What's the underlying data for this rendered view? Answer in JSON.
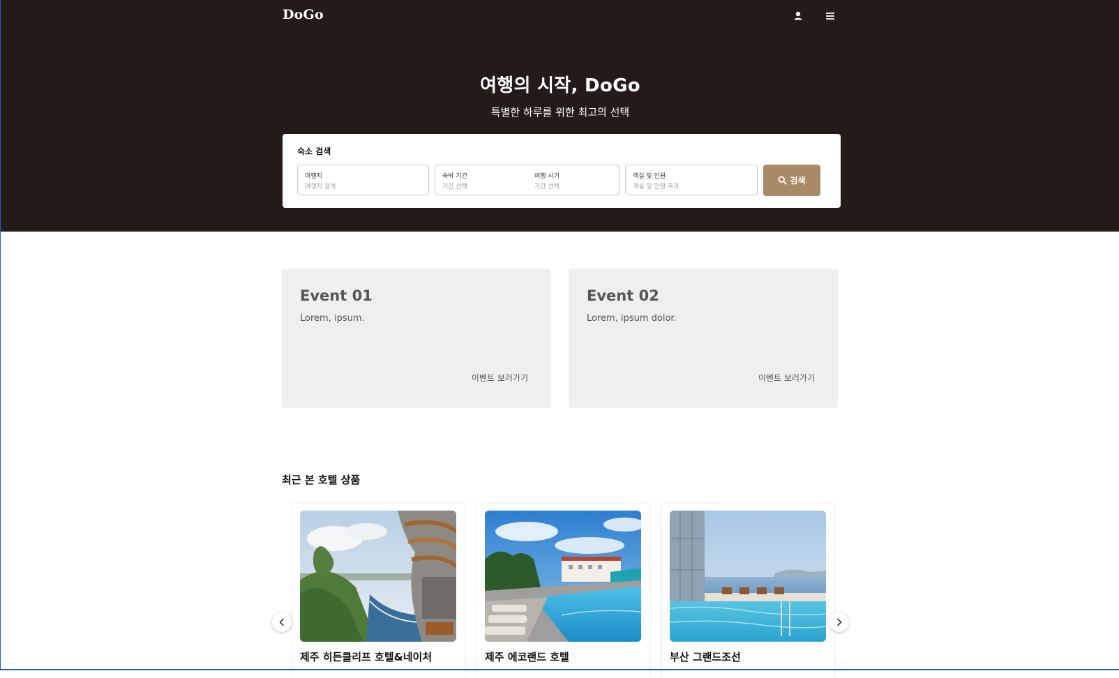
{
  "header": {
    "logo": "DoGo",
    "user_icon": "user-icon",
    "menu_icon": "hamburger-menu-icon"
  },
  "hero": {
    "title": "여행의 시작, DoGo",
    "subtitle": "특별한 하루를 위한 최고의 선택"
  },
  "search": {
    "title": "숙소 검색",
    "destination": {
      "label": "여행지",
      "placeholder": "여행지 검색"
    },
    "stay_period": {
      "label": "숙박 기간",
      "placeholder": "기간 선택"
    },
    "travel_time": {
      "label": "여행 시기",
      "placeholder": "기간 선택"
    },
    "guests": {
      "label": "객실 및 인원",
      "placeholder": "객실 및 인원 추가"
    },
    "button_label": "검색",
    "button_icon": "search-icon",
    "accent_color": "#a98a66"
  },
  "events": [
    {
      "title": "Event 01",
      "description": "Lorem, ipsum.",
      "link": "이벤트 보러가기"
    },
    {
      "title": "Event 02",
      "description": "Lorem, ipsum dolor.",
      "link": "이벤트 보러가기"
    }
  ],
  "recent": {
    "title": "최근 본 호텔 상품",
    "hotels": [
      {
        "name": "제주 히든클리프 호텔&네이처"
      },
      {
        "name": "제주 에코랜드 호텔"
      },
      {
        "name": "부산 그랜드조선"
      }
    ],
    "prev_icon": "chevron-left-icon",
    "next_icon": "chevron-right-icon"
  },
  "colors": {
    "hero_bg": "#231a1a",
    "event_card_bg": "#efefef"
  }
}
